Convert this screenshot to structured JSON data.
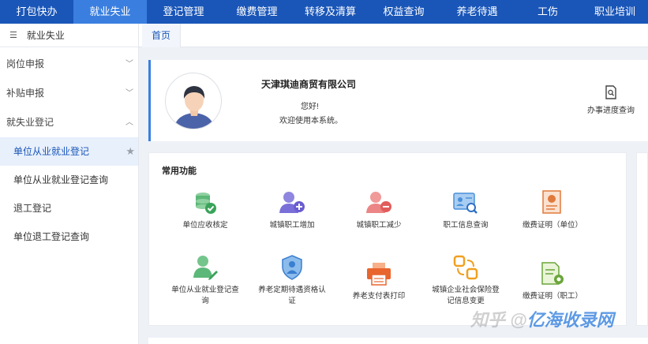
{
  "topnav": {
    "items": [
      {
        "label": "打包快办"
      },
      {
        "label": "就业失业"
      },
      {
        "label": "登记管理"
      },
      {
        "label": "缴费管理"
      },
      {
        "label": "转移及清算"
      },
      {
        "label": "权益查询"
      },
      {
        "label": "养老待遇"
      },
      {
        "label": "工伤"
      },
      {
        "label": "职业培训"
      }
    ],
    "active_index": 1
  },
  "sidebar": {
    "header": "就业失业",
    "groups": [
      {
        "label": "岗位申报",
        "expanded": false
      },
      {
        "label": "补贴申报",
        "expanded": false
      },
      {
        "label": "就失业登记",
        "expanded": true
      }
    ],
    "sub_items": [
      {
        "label": "单位从业就业登记",
        "active": true
      },
      {
        "label": "单位从业就业登记查询"
      },
      {
        "label": "退工登记"
      },
      {
        "label": "单位退工登记查询"
      }
    ]
  },
  "tabs": [
    {
      "label": "首页"
    }
  ],
  "profile": {
    "company": "天津琪迪商贸有限公司",
    "greeting": "您好!",
    "welcome": "欢迎使用本系统。",
    "progress_link": "办事进度查询"
  },
  "functions": {
    "title": "常用功能",
    "items": [
      {
        "label": "单位应收核定",
        "icon": "coins-check-icon"
      },
      {
        "label": "城镇职工增加",
        "icon": "user-add-icon"
      },
      {
        "label": "城镇职工减少",
        "icon": "user-remove-icon"
      },
      {
        "label": "职工信息查询",
        "icon": "id-card-search-icon"
      },
      {
        "label": "缴费证明（单位）",
        "icon": "certificate-icon"
      },
      {
        "label": "单位从业就业登记查询",
        "icon": "user-edit-icon"
      },
      {
        "label": "养老定期待遇资格认证",
        "icon": "shield-user-icon"
      },
      {
        "label": "养老支付表打印",
        "icon": "printer-icon"
      },
      {
        "label": "城镇企业社会保险登记信息变更",
        "icon": "exchange-icon"
      },
      {
        "label": "缴费证明（职工）",
        "icon": "doc-gear-icon"
      }
    ]
  },
  "watermark": {
    "prefix": "知乎 @",
    "brand": "亿海收录网"
  },
  "colors": {
    "nav": "#1a56b8",
    "nav_active": "#3a7fe0",
    "accent": "#1a56b8"
  }
}
